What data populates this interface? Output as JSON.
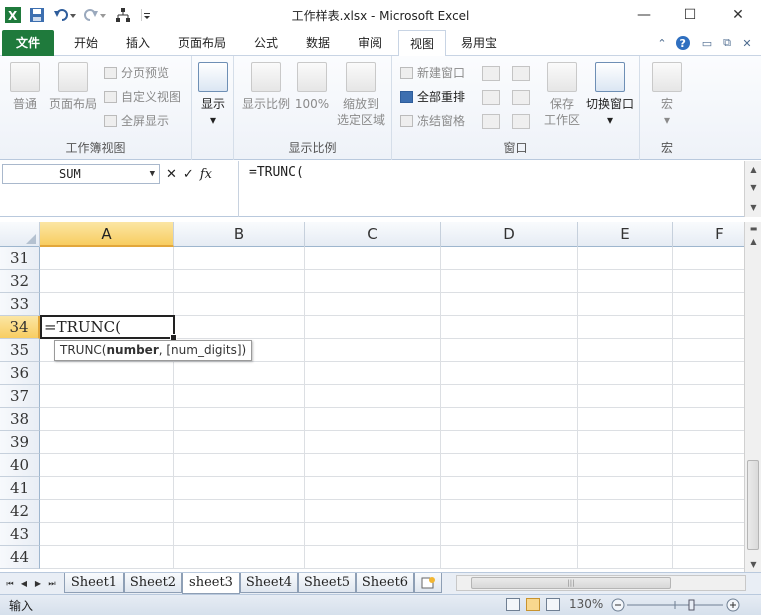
{
  "window": {
    "title": "工作样表.xlsx - Microsoft Excel",
    "minimize": "—",
    "maximize": "☐",
    "close": "✕"
  },
  "tabs": [
    {
      "label": "文件"
    },
    {
      "label": "开始"
    },
    {
      "label": "插入"
    },
    {
      "label": "页面布局"
    },
    {
      "label": "公式"
    },
    {
      "label": "数据"
    },
    {
      "label": "审阅"
    },
    {
      "label": "视图"
    },
    {
      "label": "易用宝"
    }
  ],
  "active_tab": "视图",
  "ribbon": {
    "workbook_views": {
      "label": "工作簿视图",
      "normal": "普通",
      "page_layout": "页面布局",
      "page_break_preview": "分页预览",
      "custom_views": "自定义视图",
      "full_screen": "全屏显示"
    },
    "show": {
      "label": "显示",
      "dropdown": "▾"
    },
    "zoom": {
      "label": "显示比例",
      "zoom": "显示比例",
      "hundred": "100%",
      "zoom_to_selection_1": "缩放到",
      "zoom_to_selection_2": "选定区域"
    },
    "window": {
      "label": "窗口",
      "new_window": "新建窗口",
      "arrange_all": "全部重排",
      "freeze_panes": "冻结窗格",
      "save_workspace_1": "保存",
      "save_workspace_2": "工作区",
      "switch_windows": "切换窗口"
    },
    "macros": {
      "label": "宏",
      "macro": "宏"
    }
  },
  "formula_bar": {
    "name_box": "SUM",
    "cancel": "✕",
    "enter": "✓",
    "fx": "fx",
    "formula": "=TRUNC("
  },
  "grid": {
    "columns": [
      "A",
      "B",
      "C",
      "D",
      "E",
      "F"
    ],
    "selected_column": "A",
    "rows": [
      "31",
      "32",
      "33",
      "34",
      "35",
      "36",
      "37",
      "38",
      "39",
      "40",
      "41",
      "42",
      "43",
      "44"
    ],
    "selected_row": "34",
    "active_cell_content": "=TRUNC(",
    "tooltip": {
      "fn": "TRUNC(",
      "arg1": "number",
      "rest": ", [num_digits])"
    }
  },
  "sheets": [
    "Sheet1",
    "Sheet2",
    "sheet3",
    "Sheet4",
    "Sheet5",
    "Sheet6"
  ],
  "active_sheet": "sheet3",
  "status": {
    "mode": "输入",
    "zoom": "130%"
  }
}
